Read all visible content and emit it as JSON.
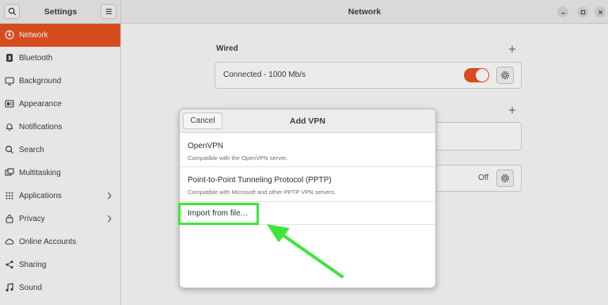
{
  "header": {
    "app_title": "Settings",
    "window_title": "Network"
  },
  "sidebar": {
    "items": [
      {
        "label": "Network",
        "icon": "network-icon",
        "active": true
      },
      {
        "label": "Bluetooth",
        "icon": "bluetooth-icon"
      },
      {
        "label": "Background",
        "icon": "background-icon"
      },
      {
        "label": "Appearance",
        "icon": "appearance-icon"
      },
      {
        "label": "Notifications",
        "icon": "bell-icon"
      },
      {
        "label": "Search",
        "icon": "search-icon"
      },
      {
        "label": "Multitasking",
        "icon": "multitasking-icon"
      },
      {
        "label": "Applications",
        "icon": "grid-icon",
        "has_chevron": true
      },
      {
        "label": "Privacy",
        "icon": "lock-icon",
        "has_chevron": true
      },
      {
        "label": "Online Accounts",
        "icon": "cloud-icon"
      },
      {
        "label": "Sharing",
        "icon": "share-icon"
      },
      {
        "label": "Sound",
        "icon": "music-note-icon"
      }
    ]
  },
  "main": {
    "wired": {
      "title": "Wired",
      "status": "Connected - 1000 Mb/s",
      "toggle_on": true
    },
    "proxy": {
      "status": "Off"
    }
  },
  "dialog": {
    "title": "Add VPN",
    "cancel_label": "Cancel",
    "options": [
      {
        "title": "OpenVPN",
        "subtitle": "Compatible with the OpenVPN server."
      },
      {
        "title": "Point-to-Point Tunneling Protocol (PPTP)",
        "subtitle": "Compatible with Microsoft and other PPTP VPN servers."
      },
      {
        "title": "Import from file…",
        "subtitle": ""
      }
    ]
  },
  "colors": {
    "accent": "#e95420",
    "highlight": "#3fe53a"
  }
}
